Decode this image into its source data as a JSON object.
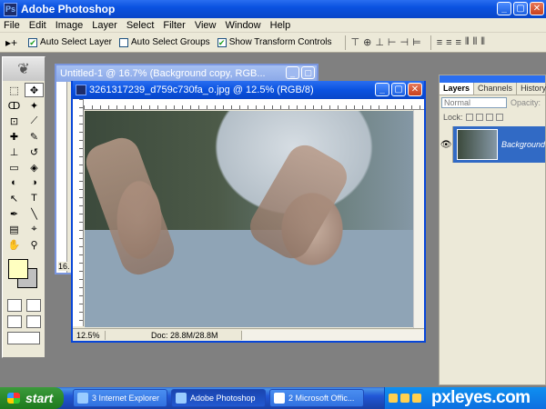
{
  "app": {
    "title": "Adobe Photoshop",
    "logo": "Ps"
  },
  "window_buttons": {
    "minimize": "_",
    "maximize": "▢",
    "close": "✕"
  },
  "menu": [
    "File",
    "Edit",
    "Image",
    "Layer",
    "Select",
    "Filter",
    "View",
    "Window",
    "Help"
  ],
  "options": {
    "tool_glyph": "▸+",
    "auto_select_layer": {
      "label": "Auto Select Layer",
      "checked": true
    },
    "auto_select_groups": {
      "label": "Auto Select Groups",
      "checked": false
    },
    "show_transform": {
      "label": "Show Transform Controls",
      "checked": true
    },
    "align_glyphs": [
      "⊤",
      "⊕",
      "⊥",
      "⊢",
      "⊣",
      "⊨",
      "≡",
      "≡",
      "≡",
      "⫴",
      "⫴",
      "⫴"
    ]
  },
  "tools": [
    {
      "icon": "marquee-icon",
      "glyph": "⬚"
    },
    {
      "icon": "move-icon",
      "glyph": "✥",
      "active": true
    },
    {
      "icon": "lasso-icon",
      "glyph": "ↀ"
    },
    {
      "icon": "magic-wand-icon",
      "glyph": "✦"
    },
    {
      "icon": "crop-icon",
      "glyph": "⊡"
    },
    {
      "icon": "slice-icon",
      "glyph": "⟋"
    },
    {
      "icon": "healing-icon",
      "glyph": "✚"
    },
    {
      "icon": "brush-icon",
      "glyph": "✎"
    },
    {
      "icon": "stamp-icon",
      "glyph": "⊥"
    },
    {
      "icon": "history-brush-icon",
      "glyph": "↺"
    },
    {
      "icon": "eraser-icon",
      "glyph": "▭"
    },
    {
      "icon": "bucket-icon",
      "glyph": "◈"
    },
    {
      "icon": "blur-icon",
      "glyph": "◐"
    },
    {
      "icon": "dodge-icon",
      "glyph": "◑"
    },
    {
      "icon": "path-select-icon",
      "glyph": "↖"
    },
    {
      "icon": "type-icon",
      "glyph": "T"
    },
    {
      "icon": "pen-icon",
      "glyph": "✒"
    },
    {
      "icon": "line-icon",
      "glyph": "╲"
    },
    {
      "icon": "notes-icon",
      "glyph": "▤"
    },
    {
      "icon": "eyedropper-icon",
      "glyph": "⌖"
    },
    {
      "icon": "hand-icon",
      "glyph": "✋"
    },
    {
      "icon": "zoom-icon",
      "glyph": "⚲"
    }
  ],
  "colors": {
    "foreground": "#ffffc0",
    "background": "#c0c0c0"
  },
  "back_document": {
    "title": "Untitled-1 @ 16.7% (Background copy, RGB...",
    "zoom": "16."
  },
  "document": {
    "title": "3261317239_d759c730fa_o.jpg @ 12.5% (RGB/8)",
    "zoom": "12.5%",
    "doc_info": "Doc: 28.8M/28.8M"
  },
  "layers_panel": {
    "tabs": [
      "Layers",
      "Channels",
      "History"
    ],
    "blend_mode": "Normal",
    "opacity_label": "Opacity:",
    "lock_label": "Lock:",
    "layer_name": "Background"
  },
  "taskbar": {
    "start": "start",
    "tasks": [
      {
        "label": "3 Internet Explorer",
        "active": false
      },
      {
        "label": "Adobe Photoshop",
        "active": true
      },
      {
        "label": "2 Microsoft Offic...",
        "active": false
      }
    ],
    "watermark": "pxleyes.com"
  }
}
